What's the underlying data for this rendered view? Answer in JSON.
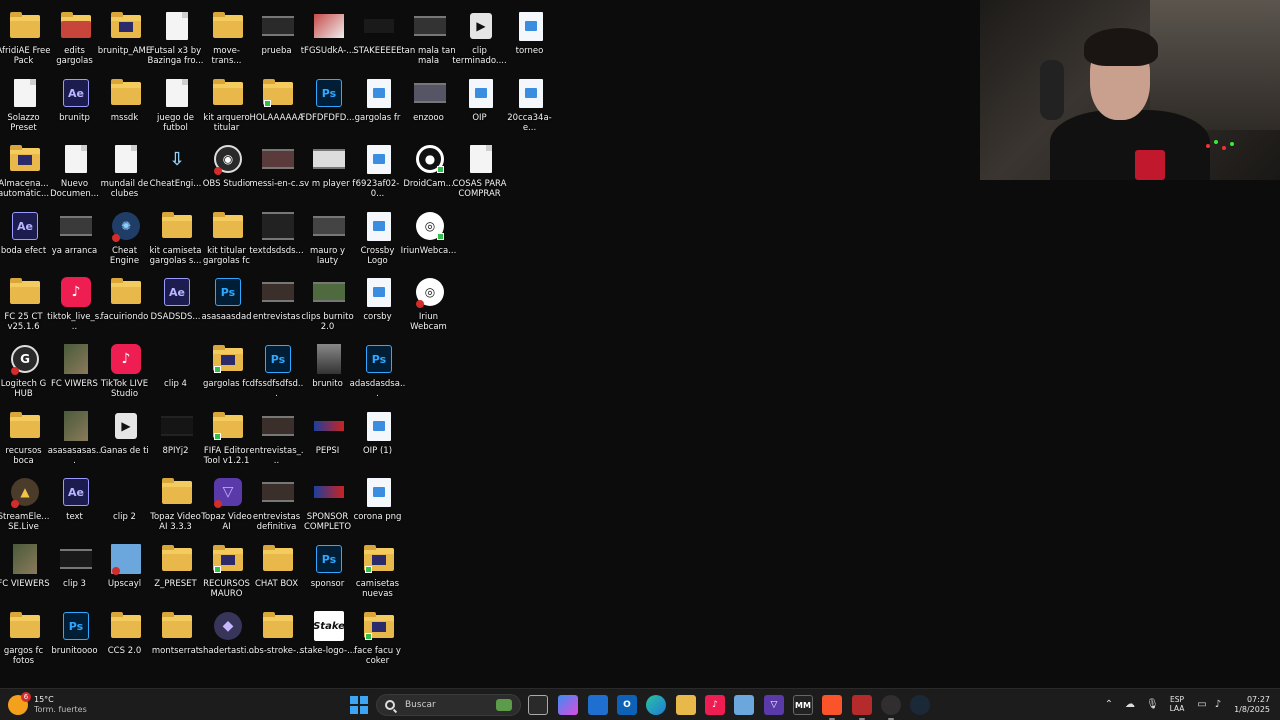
{
  "desktop": {
    "icons": [
      {
        "label": "AfridiAE Free Pack",
        "icon": "folder-icon"
      },
      {
        "label": "edits gargolas",
        "icon": "folder-icon"
      },
      {
        "label": "brunitp_AME",
        "icon": "folder-icon"
      },
      {
        "label": "Futsal x3  by Bazinga fro...",
        "icon": "document-icon"
      },
      {
        "label": "move-trans...",
        "icon": "folder-icon"
      },
      {
        "label": "prueba",
        "icon": "video-icon"
      },
      {
        "label": "tFGSUdkA-...",
        "icon": "image-thumbnail-icon"
      },
      {
        "label": "STAKEEEEE",
        "icon": "image-thumbnail-icon"
      },
      {
        "label": "tan mala tan mala",
        "icon": "video-icon"
      },
      {
        "label": "clip terminado....",
        "icon": "media-player-icon"
      },
      {
        "label": "torneo",
        "icon": "image-icon"
      },
      {
        "label": "Solazzo Preset",
        "icon": "preset-file-icon"
      },
      {
        "label": "brunitp",
        "icon": "after-effects-icon"
      },
      {
        "label": "mssdk",
        "icon": "folder-icon"
      },
      {
        "label": "juego de futbol",
        "icon": "document-icon"
      },
      {
        "label": "kit arquero titular",
        "icon": "folder-icon"
      },
      {
        "label": "HOLAAAAAA",
        "icon": "folder-icon"
      },
      {
        "label": "FDFDFDFD...",
        "icon": "photoshop-icon"
      },
      {
        "label": "gargolas fr",
        "icon": "image-icon"
      },
      {
        "label": "enzooo",
        "icon": "video-icon"
      },
      {
        "label": "OIP",
        "icon": "image-icon"
      },
      {
        "label": "20cca34a-e...",
        "icon": "image-icon"
      },
      {
        "label": "Almacena... automátic...",
        "icon": "folder-icon"
      },
      {
        "label": "Nuevo Documen...",
        "icon": "document-icon"
      },
      {
        "label": "mundail de clubes",
        "icon": "document-icon"
      },
      {
        "label": "CheatEngi...",
        "icon": "installer-icon"
      },
      {
        "label": "OBS Studio",
        "icon": "obs-icon"
      },
      {
        "label": "messi-en-c...",
        "icon": "video-icon"
      },
      {
        "label": "sv m player f",
        "icon": "video-icon"
      },
      {
        "label": "6923af02-0...",
        "icon": "image-icon"
      },
      {
        "label": "DroidCam...",
        "icon": "droidcam-icon"
      },
      {
        "label": "COSAS PARA COMPRAR",
        "icon": "document-icon"
      },
      {
        "label": "boda efect",
        "icon": "after-effects-icon"
      },
      {
        "label": "ya arranca",
        "icon": "video-icon"
      },
      {
        "label": "Cheat Engine",
        "icon": "cheat-engine-icon"
      },
      {
        "label": "kit camiseta gargolas s...",
        "icon": "folder-icon"
      },
      {
        "label": "kit titular gargolas fc",
        "icon": "folder-icon"
      },
      {
        "label": "textdsdsds...",
        "icon": "video-icon"
      },
      {
        "label": "mauro y lauty",
        "icon": "video-icon"
      },
      {
        "label": "Crossby Logo",
        "icon": "image-icon"
      },
      {
        "label": "IriunWebca...",
        "icon": "iriun-webcam-icon"
      },
      {
        "label": "FC 25 CT v25.1.6",
        "icon": "folder-icon"
      },
      {
        "label": "tiktok_live_s...",
        "icon": "tiktok-icon"
      },
      {
        "label": "facuiriondo",
        "icon": "folder-icon"
      },
      {
        "label": "DSADSDS...",
        "icon": "after-effects-icon"
      },
      {
        "label": "asasaasdad",
        "icon": "photoshop-icon"
      },
      {
        "label": "entrevistas",
        "icon": "video-icon"
      },
      {
        "label": "clips burnito 2.0",
        "icon": "video-icon"
      },
      {
        "label": "corsby",
        "icon": "image-icon"
      },
      {
        "label": "Iriun Webcam",
        "icon": "iriun-webcam-icon"
      },
      {
        "label": "Logitech G HUB",
        "icon": "logitech-icon"
      },
      {
        "label": "FC VIWERS",
        "icon": "image-thumbnail-icon"
      },
      {
        "label": "TikTok LIVE Studio",
        "icon": "tiktok-icon"
      },
      {
        "label": "clip 4",
        "icon": "video-icon"
      },
      {
        "label": "gargolas fc",
        "icon": "folder-icon"
      },
      {
        "label": "dfssdfsdfsd...",
        "icon": "photoshop-icon"
      },
      {
        "label": "brunito",
        "icon": "image-thumbnail-icon"
      },
      {
        "label": "adasdasdsa...",
        "icon": "photoshop-icon"
      },
      {
        "label": "recursos boca",
        "icon": "folder-icon"
      },
      {
        "label": "asasasasas...",
        "icon": "image-thumbnail-icon"
      },
      {
        "label": "Ganas de ti",
        "icon": "media-player-icon"
      },
      {
        "label": "8PIYj2",
        "icon": "video-icon"
      },
      {
        "label": "FIFA Editor Tool v1.2.1",
        "icon": "folder-icon"
      },
      {
        "label": "entrevistas_...",
        "icon": "video-icon"
      },
      {
        "label": "PEPSI",
        "icon": "image-thumbnail-icon"
      },
      {
        "label": "OIP (1)",
        "icon": "image-icon"
      },
      {
        "label": "StreamEle... SE.Live",
        "icon": "streamelements-icon"
      },
      {
        "label": "text",
        "icon": "after-effects-icon"
      },
      {
        "label": "clip 2",
        "icon": "video-icon"
      },
      {
        "label": "Topaz Video AI 3.3.3 (x6...",
        "icon": "folder-icon"
      },
      {
        "label": "Topaz Video AI",
        "icon": "topaz-icon"
      },
      {
        "label": "entrevistas definitiva",
        "icon": "video-icon"
      },
      {
        "label": "SPONSOR COMPLETO",
        "icon": "image-thumbnail-icon"
      },
      {
        "label": "corona png",
        "icon": "image-icon"
      },
      {
        "label": "FC VIEWERS",
        "icon": "image-thumbnail-icon"
      },
      {
        "label": "clip 3",
        "icon": "video-icon"
      },
      {
        "label": "Upscayl",
        "icon": "upscayl-icon"
      },
      {
        "label": "Z_PRESET",
        "icon": "folder-icon"
      },
      {
        "label": "RECURSOS MAURO",
        "icon": "folder-icon"
      },
      {
        "label": "CHAT BOX",
        "icon": "folder-icon"
      },
      {
        "label": "sponsor",
        "icon": "photoshop-icon"
      },
      {
        "label": "camisetas nuevas",
        "icon": "folder-icon"
      },
      {
        "label": "gargos fc fotos",
        "icon": "folder-icon"
      },
      {
        "label": "brunitoooo",
        "icon": "photoshop-icon"
      },
      {
        "label": "CCS 2.0",
        "icon": "folder-icon"
      },
      {
        "label": "montserrat",
        "icon": "folder-icon"
      },
      {
        "label": "shadertasti...",
        "icon": "shader-icon"
      },
      {
        "label": "obs-stroke-...",
        "icon": "folder-icon"
      },
      {
        "label": "stake-logo-...",
        "icon": "stake-icon"
      },
      {
        "label": "face facu y coker",
        "icon": "folder-icon"
      }
    ]
  },
  "glyph_text": {
    "ae": "Ae",
    "ps": "Ps",
    "stake": "Stake"
  },
  "taskbar": {
    "weather": {
      "temp": "15°C",
      "desc": "Torm. fuertes",
      "badge": "6"
    },
    "search": {
      "placeholder": "Buscar"
    },
    "lang": {
      "line1": "ESP",
      "line2": "LAA"
    },
    "clock": {
      "time": "07:27",
      "date": "1/8/2025"
    }
  }
}
